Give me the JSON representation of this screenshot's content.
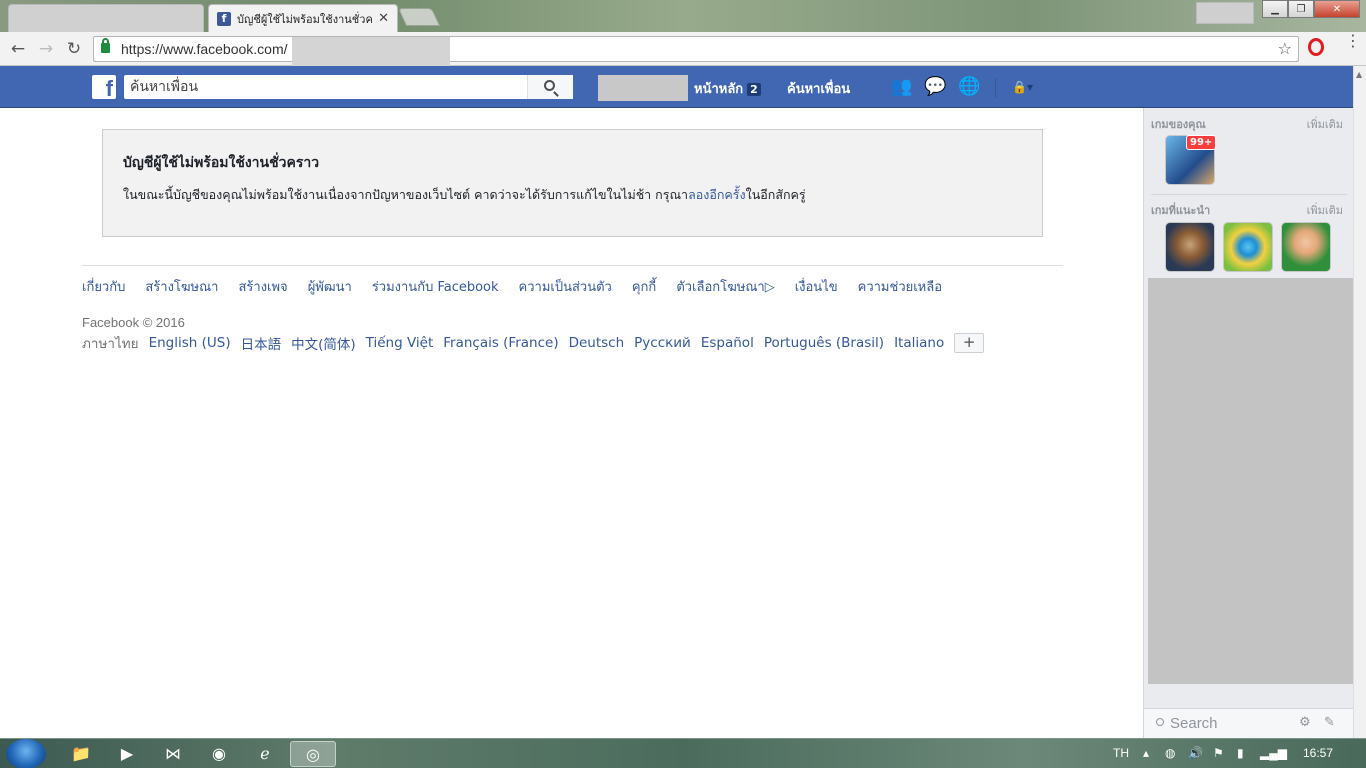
{
  "browser": {
    "active_tab_title": "บัญชีผู้ใช้ไม่พร้อมใช้งานชั่วค",
    "url": "https://www.facebook.com/"
  },
  "fb_header": {
    "search_placeholder": "ค้นหาเพื่อน",
    "home_label": "หน้าหลัก",
    "home_count": "2",
    "find_friends_label": "ค้นหาเพื่อน"
  },
  "notice": {
    "title": "บัญชีผู้ใช้ไม่พร้อมใช้งานชั่วคราว",
    "body_before": "ในขณะนี้บัญชีของคุณไม่พร้อมใช้งานเนื่องจากปัญหาของเว็บไซต์ คาดว่าจะได้รับการแก้ไขในไม่ช้า กรุณา",
    "retry_link": "ลองอีกครั้ง",
    "body_after": "ในอีกสักครู่"
  },
  "footer": {
    "links": [
      "เกี่ยวกับ",
      "สร้างโฆษณา",
      "สร้างเพจ",
      "ผู้พัฒนา",
      "ร่วมงานกับ Facebook",
      "ความเป็นส่วนตัว",
      "คุกกี้",
      "ตัวเลือกโฆษณา▷",
      "เงื่อนไข",
      "ความช่วยเหลือ"
    ],
    "copyright": "Facebook © 2016",
    "current_language": "ภาษาไทย",
    "languages": [
      "English (US)",
      "日本語",
      "中文(简体)",
      "Tiếng Việt",
      "Français (France)",
      "Deutsch",
      "Русский",
      "Español",
      "Português (Brasil)",
      "Italiano"
    ],
    "more_languages": "+"
  },
  "sidebar": {
    "your_games_label": "เกมของคุณ",
    "more_label_1": "เพิ่มเติม",
    "game_badge": "99+",
    "suggested_games_label": "เกมที่แนะนำ",
    "more_label_2": "เพิ่มเติม",
    "chat_search_placeholder": "Search"
  },
  "taskbar": {
    "language": "TH",
    "time": "16:57"
  }
}
